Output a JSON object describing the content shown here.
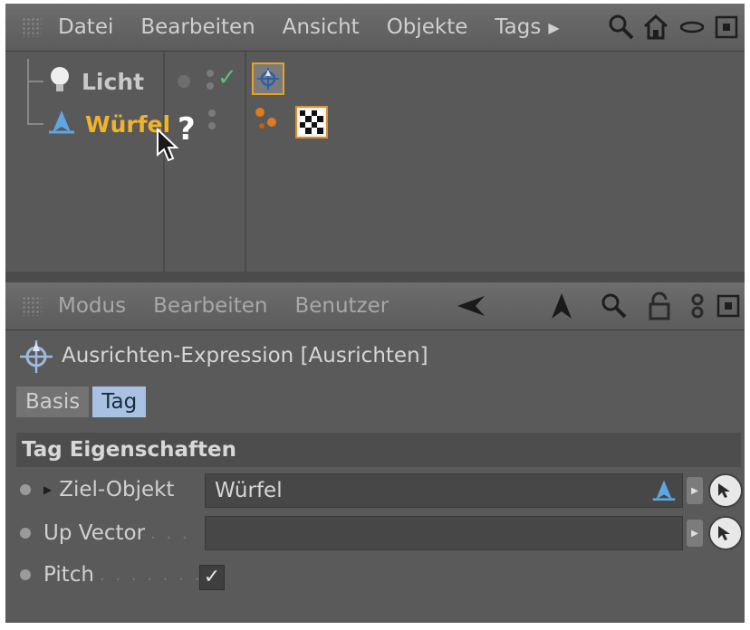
{
  "object_manager": {
    "menu": [
      "Datei",
      "Bearbeiten",
      "Ansicht",
      "Objekte",
      "Tags"
    ],
    "objects": [
      {
        "label": "Licht",
        "color": "#c9c9c9"
      },
      {
        "label": "Würfel",
        "color": "#f0b429"
      }
    ],
    "help_mark": "?"
  },
  "attribute_manager": {
    "menu": [
      "Modus",
      "Bearbeiten",
      "Benutzer"
    ],
    "title": "Ausrichten-Expression [Ausrichten]",
    "tabs": [
      {
        "label": "Basis",
        "active": false
      },
      {
        "label": "Tag",
        "active": true
      }
    ],
    "section": "Tag Eigenschaften",
    "fields": {
      "ziel_objekt": {
        "label": "Ziel-Objekt",
        "value": "Würfel"
      },
      "up_vector": {
        "label": "Up Vector",
        "dots": ". . .",
        "value": ""
      },
      "pitch": {
        "label": "Pitch",
        "dots": ". . . . . . .",
        "checked": true
      }
    }
  },
  "colors": {
    "selected_object": "#f0b429",
    "active_tab": "#a9c2e3",
    "selection_frame": "#e8a21f"
  },
  "icons": {
    "top_toolbar": [
      "search-icon",
      "home-icon",
      "view-icon",
      "panel-icon"
    ],
    "attr_toolbar": [
      "back-arrow-icon",
      "up-arrow-icon",
      "search-icon",
      "lock-icon",
      "link-icon",
      "panel-icon"
    ]
  }
}
